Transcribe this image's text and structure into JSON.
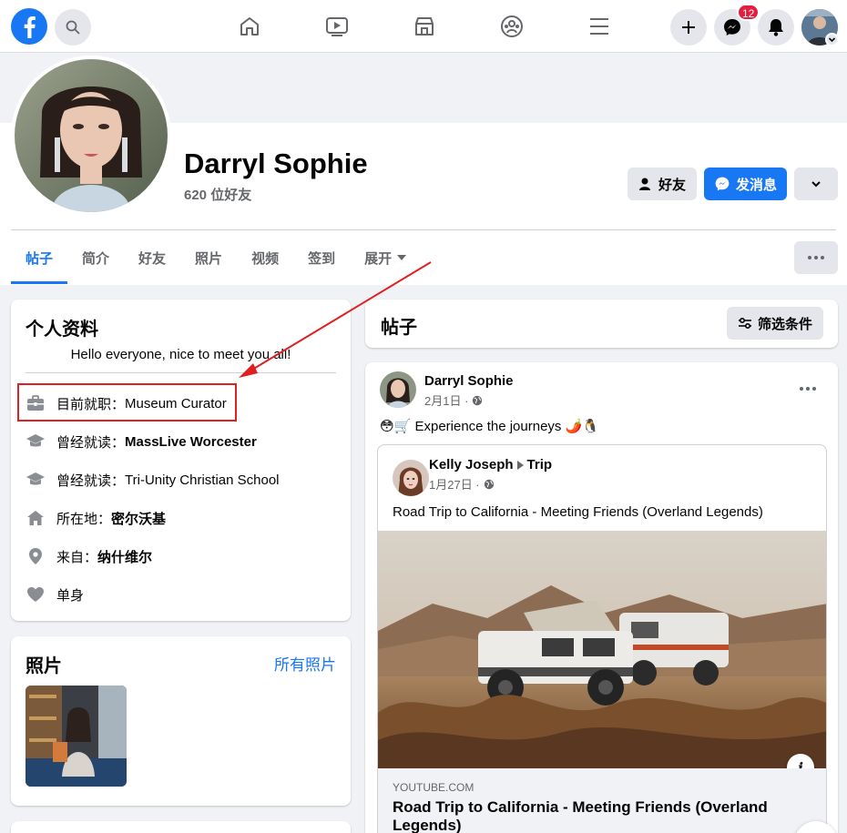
{
  "nav": {
    "messenger_badge": "12"
  },
  "profile": {
    "name": "Darryl Sophie",
    "friend_count": "620 位好友",
    "friends_button": "好友",
    "message_button": "发消息"
  },
  "tabs": [
    {
      "label": "帖子"
    },
    {
      "label": "简介"
    },
    {
      "label": "好友"
    },
    {
      "label": "照片"
    },
    {
      "label": "视频"
    },
    {
      "label": "签到"
    },
    {
      "label": "展开"
    }
  ],
  "intro": {
    "title": "个人资料",
    "bio": "Hello everyone, nice to meet you all!",
    "work_prefix": "目前就职：",
    "work_value": "Museum Curator",
    "edu1_prefix": "曾经就读：",
    "edu1_value": "MassLive Worcester",
    "edu2_prefix": "曾经就读：",
    "edu2_value": "Tri-Unity Christian School",
    "location_prefix": "所在地：",
    "location_value": "密尔沃基",
    "from_prefix": "来自：",
    "from_value": "纳什维尔",
    "relationship": "单身"
  },
  "photos": {
    "title": "照片",
    "see_all": "所有照片"
  },
  "posts_header": {
    "title": "帖子",
    "filter_label": "筛选条件"
  },
  "post": {
    "author": "Darryl Sophie",
    "date": "2月1日 ·",
    "text": "😳🛒 Experience the journeys 🌶️🐧",
    "shared_author": "Kelly Joseph",
    "shared_target": "Trip",
    "shared_date": "1月27日 ·",
    "shared_text": "Road Trip to California - Meeting Friends (Overland Legends)",
    "link_domain": "YOUTUBE.COM",
    "link_title": "Road Trip to California - Meeting Friends (Overland Legends)"
  },
  "colors": {
    "brand": "#1877f2",
    "badge": "#e41e3f",
    "annotation": "#e02020"
  }
}
